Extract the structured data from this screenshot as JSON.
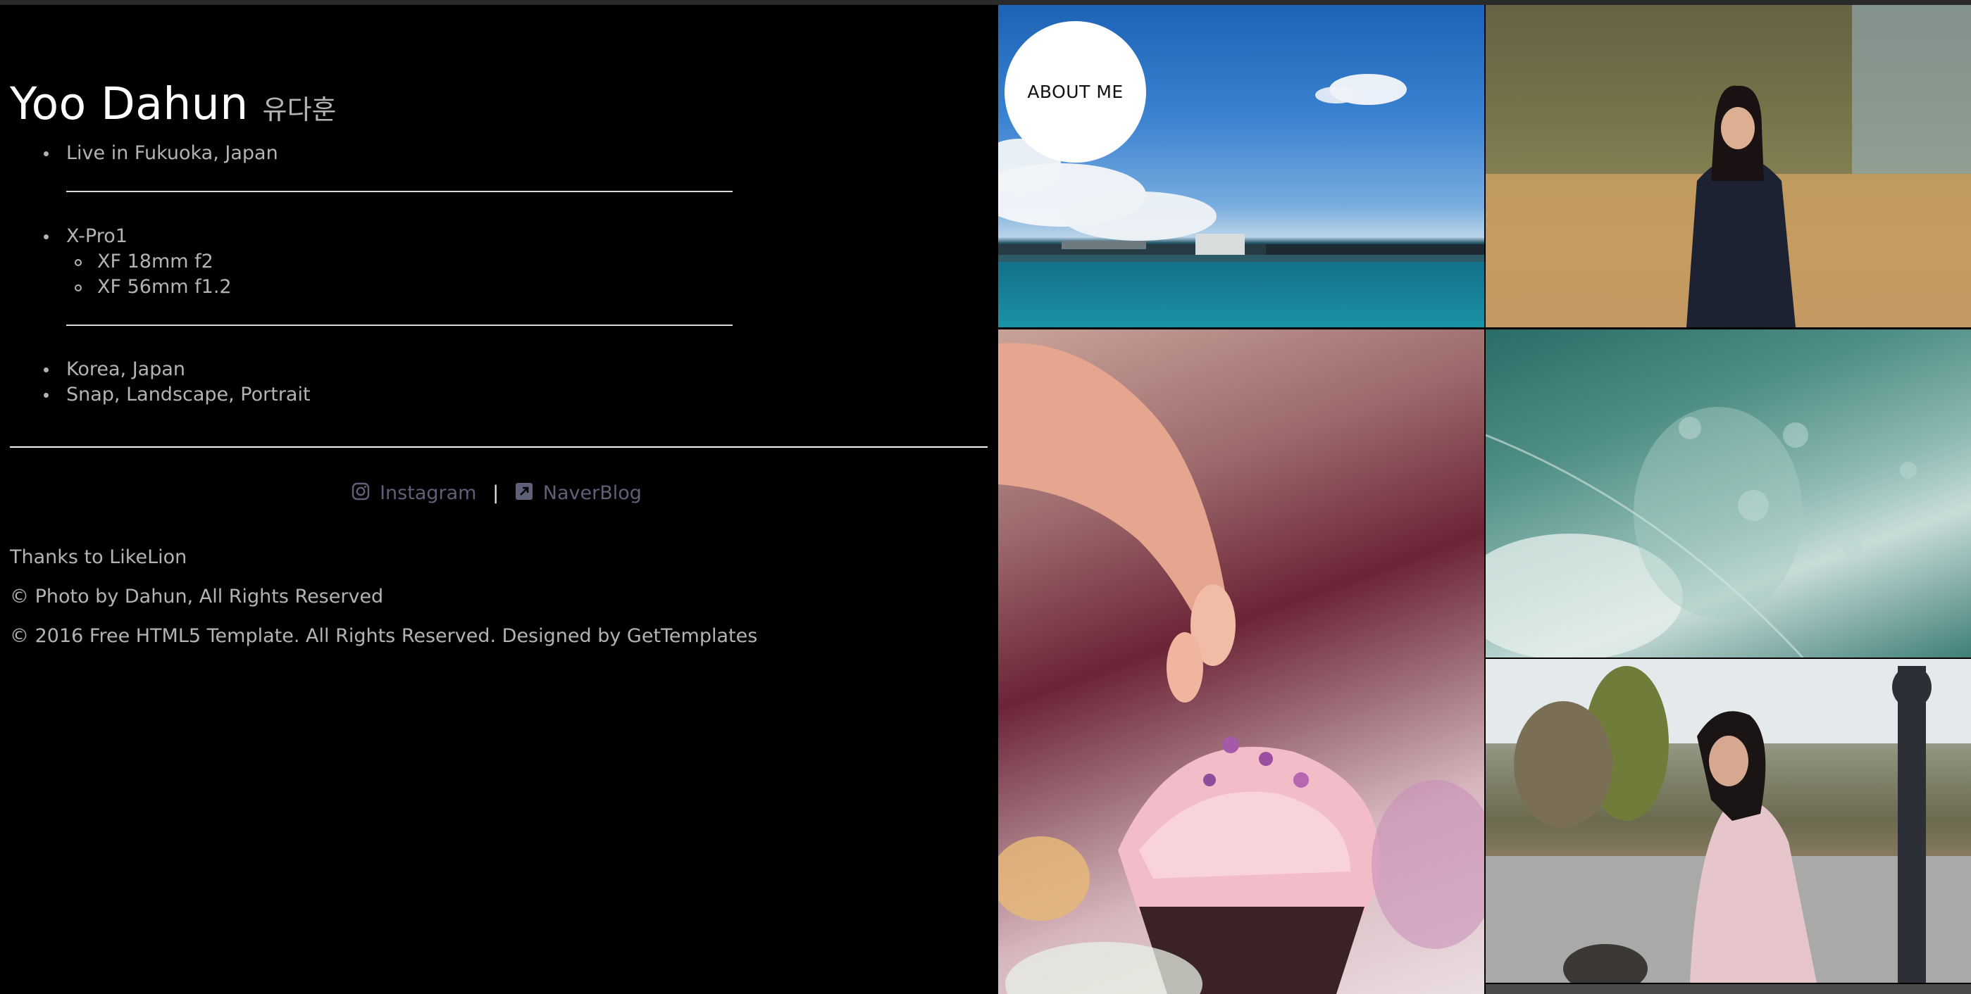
{
  "profile": {
    "name": "Yoo Dahun",
    "name_korean": "유다훈",
    "location": "Live in Fukuoka, Japan",
    "camera": "X-Pro1",
    "lenses": [
      "XF 18mm f2",
      "XF 56mm f1.2"
    ],
    "places": "Korea, Japan",
    "genres": "Snap, Landscape, Portrait"
  },
  "social": {
    "instagram_label": "Instagram",
    "separator": "|",
    "blog_label": "NaverBlog",
    "link_color": "#5f5f78"
  },
  "footer": {
    "thanks": "Thanks to LikeLion",
    "photo_credit": "© Photo by Dahun, All Rights Reserved",
    "template_credit": "© 2016 Free HTML5 Template. All Rights Reserved. Designed by GetTemplates"
  },
  "gallery": {
    "about_label": "ABOUT ME"
  }
}
